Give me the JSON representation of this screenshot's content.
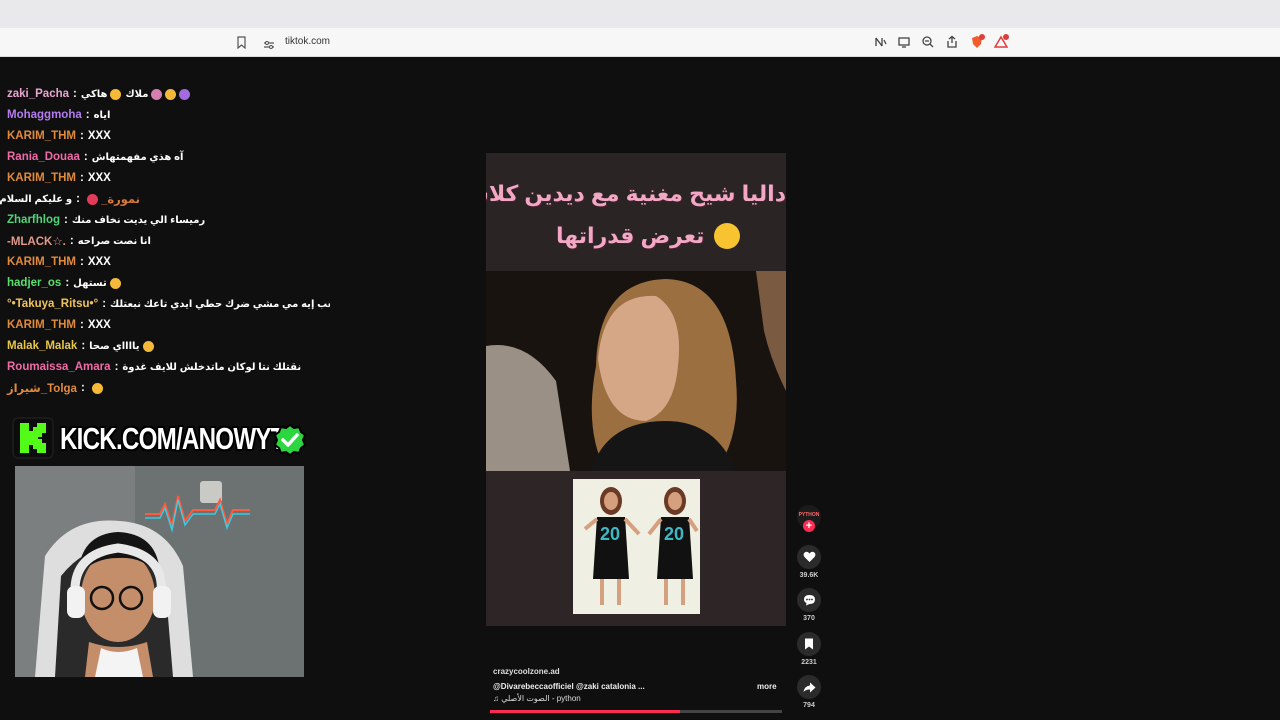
{
  "browser": {
    "url": "tiktok.com"
  },
  "chat": {
    "messages": [
      {
        "user": "zaki_Pacha",
        "text": "هاكي",
        "color": "#e9a4d0",
        "suffix": "ملاك"
      },
      {
        "user": "Mohaggmoha",
        "text": "اياه",
        "color": "#b47cf0"
      },
      {
        "user": "KARIM_THM",
        "text": "XXX",
        "color": "#e08a3c"
      },
      {
        "user": "Rania_Douaa",
        "text": "آه هذي مفهمتهاش",
        "color": "#f06aa8"
      },
      {
        "user": "KARIM_THM",
        "text": "XXX",
        "color": "#e08a3c"
      },
      {
        "user": "نمورة_",
        "text": "و عليكم السلام",
        "color": "#d87a3c"
      },
      {
        "user": "Zharfhlog",
        "text": "رميساء الي يديت نخاف منك",
        "color": "#4fd47a"
      },
      {
        "user": "-MLACK☆.",
        "text": "انا نصت صراحه",
        "color": "#e09a8a"
      },
      {
        "user": "KARIM_THM",
        "text": "XXX",
        "color": "#e08a3c"
      },
      {
        "user": "hadjer_os",
        "text": "تستهل",
        "color": "#58e06c"
      },
      {
        "user": "°•Takuya_Ritsu•°",
        "text": "نلعب إيه مي مشي ضرك حطي ايدي تاعك نبعتلك",
        "color": "#f0c45c"
      },
      {
        "user": "KARIM_THM",
        "text": "XXX",
        "color": "#e08a3c"
      },
      {
        "user": "Malak_Malak",
        "text": "يااااي صحا",
        "color": "#e8c64a"
      },
      {
        "user": "Roumaissa_Amara",
        "text": "نقتلك نتا لوكان ماتدخلش للايف غدوة",
        "color": "#f06aa8"
      },
      {
        "user": "شيراز_Tolga",
        "text": "",
        "color": "#e08a3c"
      }
    ]
  },
  "banner": {
    "text": "KICK.COM/ANOWYT"
  },
  "video": {
    "caption_line1": "داليا شيح مغنية مع ديدين كلاش",
    "caption_line2": "تعرض قدراتها",
    "author": "crazycoolzone.ad",
    "description": "@Divarebeccaofficiel  @zaki catalonia  ...",
    "more_label": "more",
    "music": "الصوت الأصلي - python",
    "progress": 0.65,
    "jersey_number": "20"
  },
  "actions": {
    "avatar_label": "PYTHON",
    "likes": "39.6K",
    "comments": "370",
    "saves": "2231",
    "shares": "794"
  }
}
